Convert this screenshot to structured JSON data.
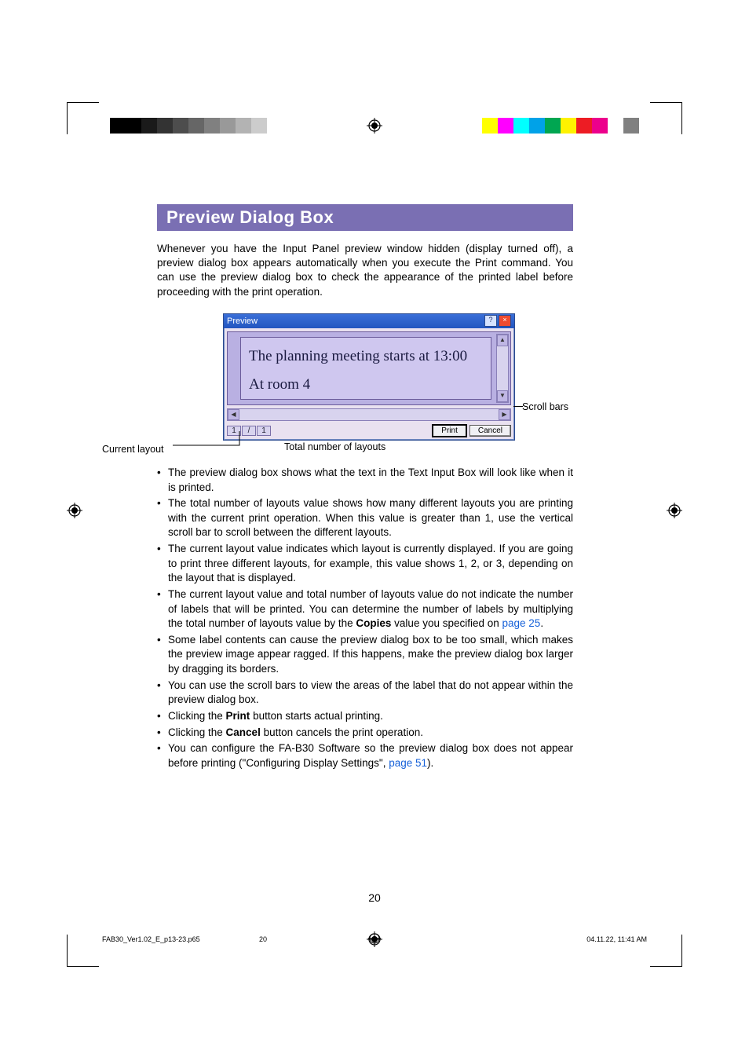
{
  "heading": "Preview Dialog Box",
  "intro": "Whenever you have the Input Panel preview window hidden (display turned off), a preview dialog box appears automatically when you execute the Print command. You can use the preview dialog box to check the appearance of the printed label before proceeding with the print operation.",
  "dialog": {
    "title": "Preview",
    "help_btn": "?",
    "close_btn": "×",
    "label_line1": "The planning meeting starts at 13:00",
    "label_line2": "At room 4",
    "counter_current": "1",
    "counter_sep": "/",
    "counter_total": "1",
    "print_btn": "Print",
    "cancel_btn": "Cancel"
  },
  "callouts": {
    "scrollbars": "Scroll bars",
    "current_layout": "Current layout",
    "total_layouts": "Total number of layouts"
  },
  "bullets": [
    {
      "pre": "The preview dialog box shows what the text in the Text Input Box will look like when it is printed."
    },
    {
      "pre": "The total number of layouts value shows how many different layouts you are printing with the current print operation. When this value is greater than 1, use the vertical scroll bar to scroll between the different layouts."
    },
    {
      "pre": "The current layout value indicates which layout is currently displayed. If you are going to print three different layouts, for example, this value shows 1, 2, or 3, depending on the layout that is displayed."
    },
    {
      "pre": "The current layout value and total number of layouts value do not indicate the number of labels that will be printed. You can determine the number of labels by multiplying the total number of layouts value by the ",
      "bold": "Copies",
      "post": " value you specified on ",
      "link": "page 25",
      "tail": "."
    },
    {
      "pre": "Some label contents can cause the preview dialog box to be too small, which makes the preview image appear ragged. If this happens, make the preview dialog box larger by dragging its borders."
    },
    {
      "pre": "You can use the scroll bars to view the areas of the label that do not appear within the preview dialog box."
    },
    {
      "pre": "Clicking the ",
      "bold": "Print",
      "post": " button starts actual printing."
    },
    {
      "pre": "Clicking the ",
      "bold": "Cancel",
      "post": " button cancels the print operation."
    },
    {
      "pre": "You can configure the FA-B30 Software so the preview dialog box does not appear before printing (\"Configuring Display Settings\", ",
      "link": "page 51",
      "tail": ")."
    }
  ],
  "page_number": "20",
  "footer": {
    "file": "FAB30_Ver1.02_E_p13-23.p65",
    "page": "20",
    "datetime": "04.11.22, 11:41 AM"
  },
  "colorbars": {
    "left": [
      "#000000",
      "#000000",
      "#1a1a1a",
      "#333333",
      "#4d4d4d",
      "#666666",
      "#808080",
      "#999999",
      "#b3b3b3",
      "#cccccc",
      "#ffffff"
    ],
    "right": [
      "#ffffff",
      "#ffff00",
      "#ff00ff",
      "#00ffff",
      "#00a2e8",
      "#00a651",
      "#fff200",
      "#ed1c24",
      "#ec008c",
      "#ffffff",
      "#808080"
    ]
  }
}
